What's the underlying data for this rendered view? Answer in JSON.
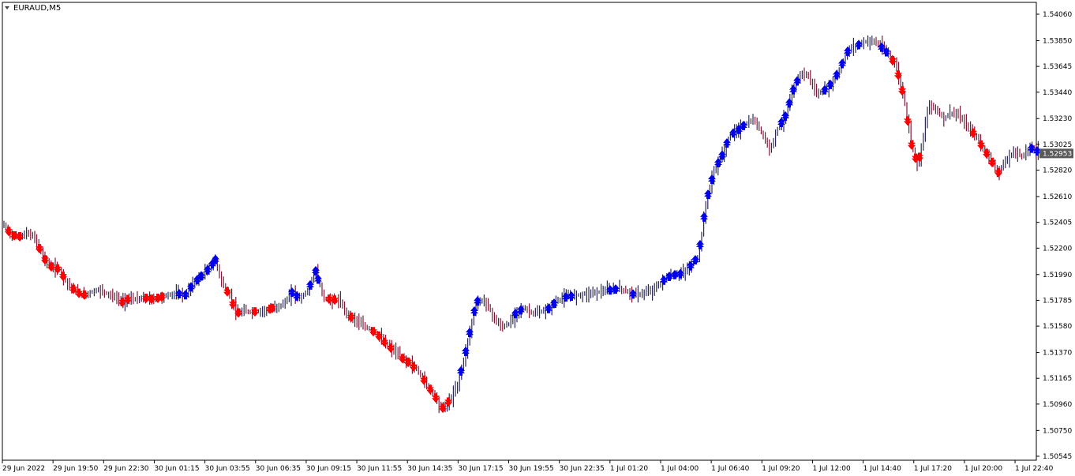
{
  "window": {
    "title": "EURAUD,M5",
    "menu_icon": "triangle-down-icon"
  },
  "chart_data": {
    "type": "bar",
    "symbol": "EURAUD",
    "timeframe": "M5",
    "title": "EURAUD,M5",
    "grid": false,
    "ylim": [
      1.50545,
      1.5406
    ],
    "y_ticks": [
      "1.54060",
      "1.53850",
      "1.53645",
      "1.53440",
      "1.53230",
      "1.53025",
      "1.52820",
      "1.52610",
      "1.52405",
      "1.52200",
      "1.51990",
      "1.51785",
      "1.51580",
      "1.51370",
      "1.51165",
      "1.50960",
      "1.50750",
      "1.50545"
    ],
    "x_ticks": [
      "29 Jun 2022",
      "29 Jun 19:50",
      "29 Jun 22:30",
      "30 Jun 01:15",
      "30 Jun 03:55",
      "30 Jun 06:35",
      "30 Jun 09:15",
      "30 Jun 11:55",
      "30 Jun 14:35",
      "30 Jun 17:15",
      "30 Jun 19:55",
      "30 Jun 22:35",
      "1 Jul 01:20",
      "1 Jul 04:00",
      "1 Jul 06:40",
      "1 Jul 09:20",
      "1 Jul 12:00",
      "1 Jul 14:40",
      "1 Jul 17:20",
      "1 Jul 20:00",
      "1 Jul 22:40"
    ],
    "current_price": "1.52953",
    "colors": {
      "bar": "#2a2a55",
      "bar_alt": "#7a1a3a",
      "arrow_up": "#0000ee",
      "arrow_down": "#ff0000",
      "price_tag": "#5a5a5a",
      "axis": "#000000"
    },
    "close_path": [
      [
        0,
        1.5238
      ],
      [
        10,
        1.523
      ],
      [
        20,
        1.5229
      ],
      [
        30,
        1.5232
      ],
      [
        40,
        1.5227
      ],
      [
        50,
        1.5212
      ],
      [
        60,
        1.5205
      ],
      [
        70,
        1.5203
      ],
      [
        80,
        1.5192
      ],
      [
        90,
        1.5186
      ],
      [
        100,
        1.5182
      ],
      [
        110,
        1.5185
      ],
      [
        120,
        1.5187
      ],
      [
        130,
        1.5184
      ],
      [
        140,
        1.5181
      ],
      [
        150,
        1.5177
      ],
      [
        160,
        1.518
      ],
      [
        170,
        1.5179
      ],
      [
        180,
        1.518
      ],
      [
        190,
        1.5179
      ],
      [
        200,
        1.5181
      ],
      [
        210,
        1.5183
      ],
      [
        220,
        1.5184
      ],
      [
        230,
        1.5183
      ],
      [
        240,
        1.5192
      ],
      [
        250,
        1.5198
      ],
      [
        260,
        1.5204
      ],
      [
        268,
        1.5211
      ],
      [
        275,
        1.5194
      ],
      [
        285,
        1.5183
      ],
      [
        295,
        1.5168
      ],
      [
        305,
        1.517
      ],
      [
        315,
        1.5169
      ],
      [
        325,
        1.517
      ],
      [
        335,
        1.5171
      ],
      [
        345,
        1.5173
      ],
      [
        355,
        1.5176
      ],
      [
        365,
        1.5185
      ],
      [
        375,
        1.518
      ],
      [
        385,
        1.5186
      ],
      [
        395,
        1.5202
      ],
      [
        405,
        1.518
      ],
      [
        415,
        1.5179
      ],
      [
        425,
        1.5178
      ],
      [
        435,
        1.5167
      ],
      [
        445,
        1.5163
      ],
      [
        455,
        1.5158
      ],
      [
        465,
        1.5155
      ],
      [
        475,
        1.515
      ],
      [
        485,
        1.5143
      ],
      [
        495,
        1.5138
      ],
      [
        505,
        1.5132
      ],
      [
        515,
        1.5128
      ],
      [
        525,
        1.5122
      ],
      [
        535,
        1.5112
      ],
      [
        545,
        1.5103
      ],
      [
        555,
        1.5092
      ],
      [
        565,
        1.5099
      ],
      [
        575,
        1.5112
      ],
      [
        585,
        1.5138
      ],
      [
        595,
        1.5168
      ],
      [
        600,
        1.5178
      ],
      [
        610,
        1.5178
      ],
      [
        620,
        1.5165
      ],
      [
        630,
        1.5157
      ],
      [
        640,
        1.516
      ],
      [
        650,
        1.517
      ],
      [
        660,
        1.5172
      ],
      [
        670,
        1.5168
      ],
      [
        680,
        1.5169
      ],
      [
        690,
        1.5172
      ],
      [
        700,
        1.5178
      ],
      [
        710,
        1.5181
      ],
      [
        720,
        1.5182
      ],
      [
        730,
        1.5183
      ],
      [
        740,
        1.5184
      ],
      [
        750,
        1.5185
      ],
      [
        760,
        1.5186
      ],
      [
        770,
        1.5187
      ],
      [
        780,
        1.5188
      ],
      [
        790,
        1.5185
      ],
      [
        800,
        1.5183
      ],
      [
        810,
        1.5184
      ],
      [
        820,
        1.5186
      ],
      [
        830,
        1.5191
      ],
      [
        840,
        1.5197
      ],
      [
        850,
        1.5199
      ],
      [
        860,
        1.52
      ],
      [
        870,
        1.5206
      ],
      [
        880,
        1.5214
      ],
      [
        885,
        1.5236
      ],
      [
        890,
        1.5258
      ],
      [
        895,
        1.527
      ],
      [
        900,
        1.5282
      ],
      [
        910,
        1.5294
      ],
      [
        920,
        1.531
      ],
      [
        930,
        1.5314
      ],
      [
        940,
        1.5319
      ],
      [
        950,
        1.5322
      ],
      [
        960,
        1.5312
      ],
      [
        970,
        1.5298
      ],
      [
        980,
        1.5315
      ],
      [
        990,
        1.5325
      ],
      [
        1000,
        1.5346
      ],
      [
        1010,
        1.536
      ],
      [
        1020,
        1.5356
      ],
      [
        1030,
        1.5342
      ],
      [
        1040,
        1.5346
      ],
      [
        1050,
        1.5352
      ],
      [
        1060,
        1.5364
      ],
      [
        1070,
        1.5378
      ],
      [
        1080,
        1.5381
      ],
      [
        1090,
        1.5384
      ],
      [
        1100,
        1.5385
      ],
      [
        1110,
        1.5381
      ],
      [
        1120,
        1.5375
      ],
      [
        1130,
        1.5365
      ],
      [
        1140,
        1.534
      ],
      [
        1150,
        1.5302
      ],
      [
        1158,
        1.5285
      ],
      [
        1165,
        1.531
      ],
      [
        1172,
        1.5335
      ],
      [
        1180,
        1.5331
      ],
      [
        1190,
        1.5323
      ],
      [
        1200,
        1.5328
      ],
      [
        1210,
        1.5325
      ],
      [
        1220,
        1.5317
      ],
      [
        1230,
        1.531
      ],
      [
        1240,
        1.53
      ],
      [
        1250,
        1.529
      ],
      [
        1260,
        1.528
      ],
      [
        1270,
        1.529
      ],
      [
        1280,
        1.5297
      ],
      [
        1290,
        1.5293
      ],
      [
        1300,
        1.53
      ],
      [
        1308,
        1.5298
      ],
      [
        1312,
        1.5295
      ]
    ],
    "arrows": [
      {
        "dir": "down",
        "x": [
          6,
          13,
          20,
          45,
          52,
          60,
          68,
          75,
          88,
          95,
          102,
          150,
          157,
          180,
          187,
          195,
          200,
          283,
          290,
          297,
          318,
          337,
          340,
          412,
          419,
          440,
          468,
          475,
          482,
          490,
          505,
          512,
          519,
          532,
          540,
          547,
          556,
          563,
          1126,
          1133,
          1138,
          1145,
          1150,
          1155,
          1160,
          1228,
          1238,
          1245,
          1252,
          1260
        ]
      },
      {
        "dir": "up",
        "x": [
          222,
          230,
          237,
          245,
          250,
          258,
          264,
          268,
          365,
          371,
          388,
          395,
          398,
          579,
          585,
          590,
          596,
          600,
          648,
          655,
          690,
          697,
          712,
          719,
          768,
          775,
          797,
          836,
          843,
          850,
          857,
          870,
          876,
          882,
          887,
          892,
          897,
          905,
          910,
          916,
          924,
          931,
          937,
          985,
          990,
          995,
          1000,
          1005,
          1040,
          1047,
          1055,
          1062,
          1069,
          1083,
          1112,
          1118,
          1302,
          1309
        ]
      }
    ]
  }
}
